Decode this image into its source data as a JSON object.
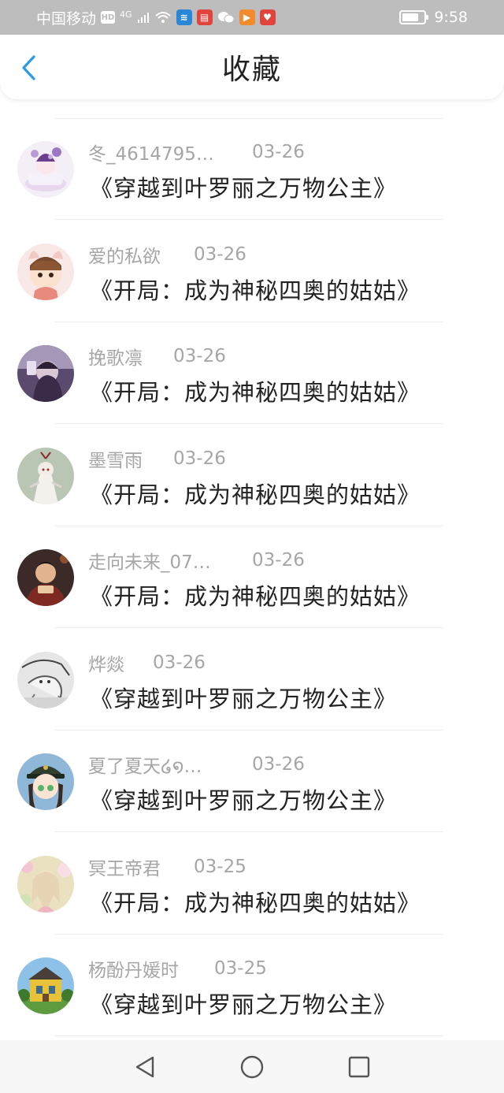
{
  "status_bar": {
    "carrier": "中国移动",
    "hd": "HD",
    "network": "4G",
    "time": "9:58"
  },
  "header": {
    "title": "收藏"
  },
  "items": [
    {
      "name": "冬_4614795…",
      "date": "03-26",
      "book": "《穿越到叶罗丽之万物公主》",
      "avatar": "avatar-lilac-cake"
    },
    {
      "name": "爱的私欲",
      "date": "03-26",
      "book": "《开局：成为神秘四奥的姑姑》",
      "avatar": "avatar-chibi-boy"
    },
    {
      "name": "挽歌凛",
      "date": "03-26",
      "book": "《开局：成为神秘四奥的姑姑》",
      "avatar": "avatar-purple-girl"
    },
    {
      "name": "墨雪雨",
      "date": "03-26",
      "book": "《开局：成为神秘四奥的姑姑》",
      "avatar": "avatar-white-figure"
    },
    {
      "name": "走向未来_07…",
      "date": "03-26",
      "book": "《开局：成为神秘四奥的姑姑》",
      "avatar": "avatar-boy-photo"
    },
    {
      "name": "烨燚",
      "date": "03-26",
      "book": "《穿越到叶罗丽之万物公主》",
      "avatar": "avatar-sketch"
    },
    {
      "name": "夏了夏天໒໑…",
      "date": "03-26",
      "book": "《穿越到叶罗丽之万物公主》",
      "avatar": "avatar-anime-cap"
    },
    {
      "name": "冥王帝君",
      "date": "03-25",
      "book": "《开局：成为神秘四奥的姑姑》",
      "avatar": "avatar-flower-girl"
    },
    {
      "name": "杨酚丹媛时",
      "date": "03-25",
      "book": "《穿越到叶罗丽之万物公主》",
      "avatar": "avatar-yellow-house"
    }
  ],
  "nav": {
    "back": "back-triangle",
    "home": "home-circle",
    "recent": "recent-square"
  }
}
